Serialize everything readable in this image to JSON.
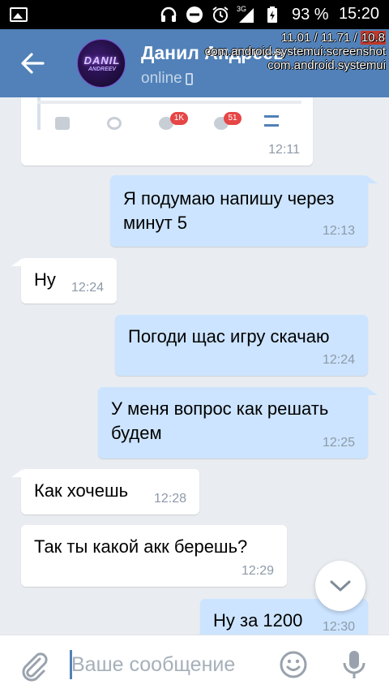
{
  "status_bar": {
    "network": "3G",
    "battery": "93 %",
    "time": "15:20"
  },
  "header": {
    "chat_name": "Данил Андреев",
    "status": "online",
    "avatar_line1": "DANIL",
    "avatar_line2": "ANDREEV"
  },
  "debug_overlay": {
    "numbers_1": "11.01",
    "numbers_2": "11.71",
    "numbers_3": "10.8",
    "line2": "com.android.systemui:screenshot",
    "line3": "com.android.systemui"
  },
  "attachment_preview": {
    "badge_1": "1K",
    "badge_2": "51"
  },
  "messages": [
    {
      "direction": "in",
      "text": "",
      "time": "12:11"
    },
    {
      "direction": "out",
      "text": "Я подумаю напишу через минут 5",
      "time": "12:13"
    },
    {
      "direction": "in",
      "text": "Ну",
      "time": "12:24"
    },
    {
      "direction": "out",
      "text": "Погоди щас игру скачаю",
      "time": "12:24"
    },
    {
      "direction": "out",
      "text": "У меня вопрос как решать будем",
      "time": "12:25"
    },
    {
      "direction": "in",
      "text": "Как хочешь",
      "time": "12:28"
    },
    {
      "direction": "in",
      "text": "Так ты какой акк берешь?",
      "time": "12:29"
    },
    {
      "direction": "out",
      "text": "Ну за 1200",
      "time": "12:30"
    }
  ],
  "input": {
    "placeholder": "Ваше сообщение",
    "value": ""
  },
  "icons": {
    "back": "arrow-left-icon",
    "attach": "paperclip-icon",
    "emoji": "smiley-icon",
    "mic": "microphone-icon",
    "scroll_down": "chevron-down-icon"
  },
  "colors": {
    "header": "#5181b8",
    "incoming": "#ffffff",
    "outgoing": "#cce4ff",
    "background": "#e9edf1"
  }
}
